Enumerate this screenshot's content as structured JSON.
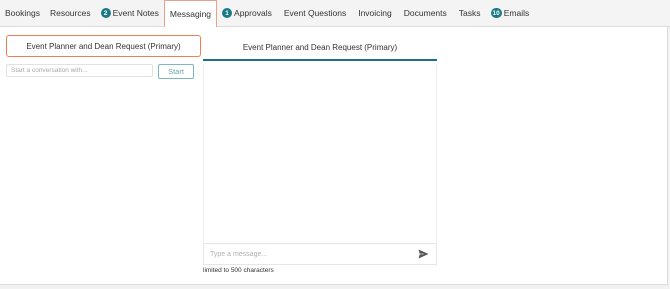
{
  "tabs": [
    {
      "label": "Bookings",
      "badge": null
    },
    {
      "label": "Resources",
      "badge": null
    },
    {
      "label": "Event Notes",
      "badge": "2"
    },
    {
      "label": "Messaging",
      "badge": null,
      "active": true
    },
    {
      "label": "Approvals",
      "badge": "1"
    },
    {
      "label": "Event Questions",
      "badge": null
    },
    {
      "label": "Invoicing",
      "badge": null
    },
    {
      "label": "Documents",
      "badge": null
    },
    {
      "label": "Tasks",
      "badge": null
    },
    {
      "label": "Emails",
      "badge": "10"
    }
  ],
  "conversations": [
    {
      "title": "Event Planner and Dean Request (Primary)",
      "selected": true
    }
  ],
  "start_conversation": {
    "placeholder": "Start a conversation with...",
    "value": "",
    "button_label": "Start"
  },
  "chat": {
    "title": "Event Planner and Dean Request (Primary)",
    "message_placeholder": "Type a message...",
    "message_value": "",
    "limit_note": "limited to 500 characters"
  },
  "colors": {
    "accent_teal": "#1a7a85",
    "active_tab_border": "#e8a08a",
    "selected_card_border": "#e9824f",
    "chat_header_underline": "#1f6f8b"
  },
  "icons": {
    "send": "send-icon"
  }
}
